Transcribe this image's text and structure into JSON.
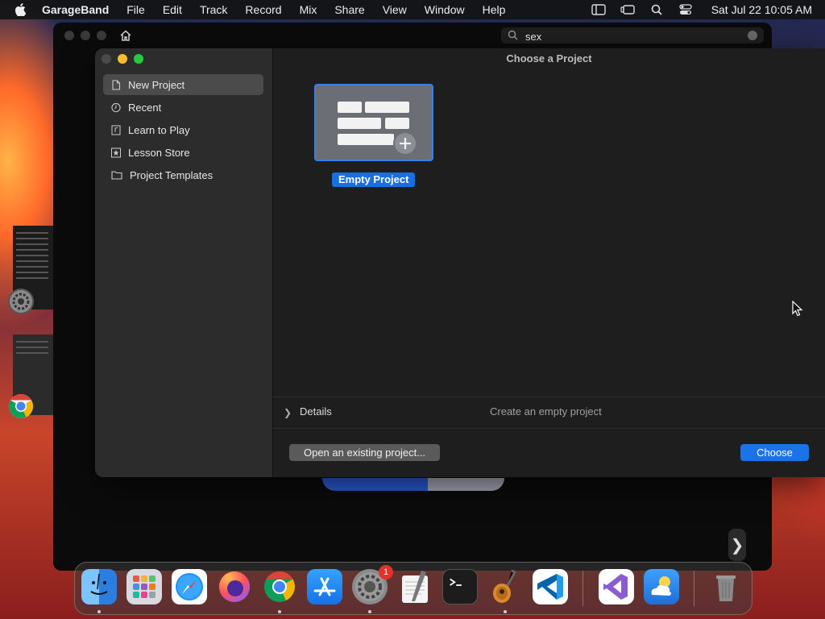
{
  "menubar": {
    "app_name": "GarageBand",
    "menus": [
      "File",
      "Edit",
      "Track",
      "Record",
      "Mix",
      "Share",
      "View",
      "Window",
      "Help"
    ],
    "clock": "Sat Jul 22  10:05 AM"
  },
  "browser": {
    "search_value": "sex"
  },
  "dialog": {
    "title": "Choose a Project",
    "sidebar": [
      {
        "label": "New Project",
        "icon": "document-icon",
        "selected": true
      },
      {
        "label": "Recent",
        "icon": "clock-icon"
      },
      {
        "label": "Learn to Play",
        "icon": "music-note-icon"
      },
      {
        "label": "Lesson Store",
        "icon": "star-icon"
      },
      {
        "label": "Project Templates",
        "icon": "folder-icon"
      }
    ],
    "tile_label": "Empty Project",
    "details_label": "Details",
    "details_description": "Create an empty project",
    "open_button": "Open an existing project...",
    "choose_button": "Choose"
  },
  "dock": {
    "apps": [
      "Finder",
      "Launchpad",
      "Safari",
      "Firefox",
      "Chrome",
      "App Store",
      "System Settings",
      "TextEdit",
      "Terminal",
      "GarageBand",
      "VS Code",
      "Visual Studio",
      "Weather",
      "Trash"
    ],
    "system_settings_badge": "1"
  },
  "colors": {
    "accent": "#1a73e8",
    "selection": "#4b4b4b",
    "dialog_bg": "#1e1e1e",
    "sidebar_bg": "#2c2c2c"
  }
}
